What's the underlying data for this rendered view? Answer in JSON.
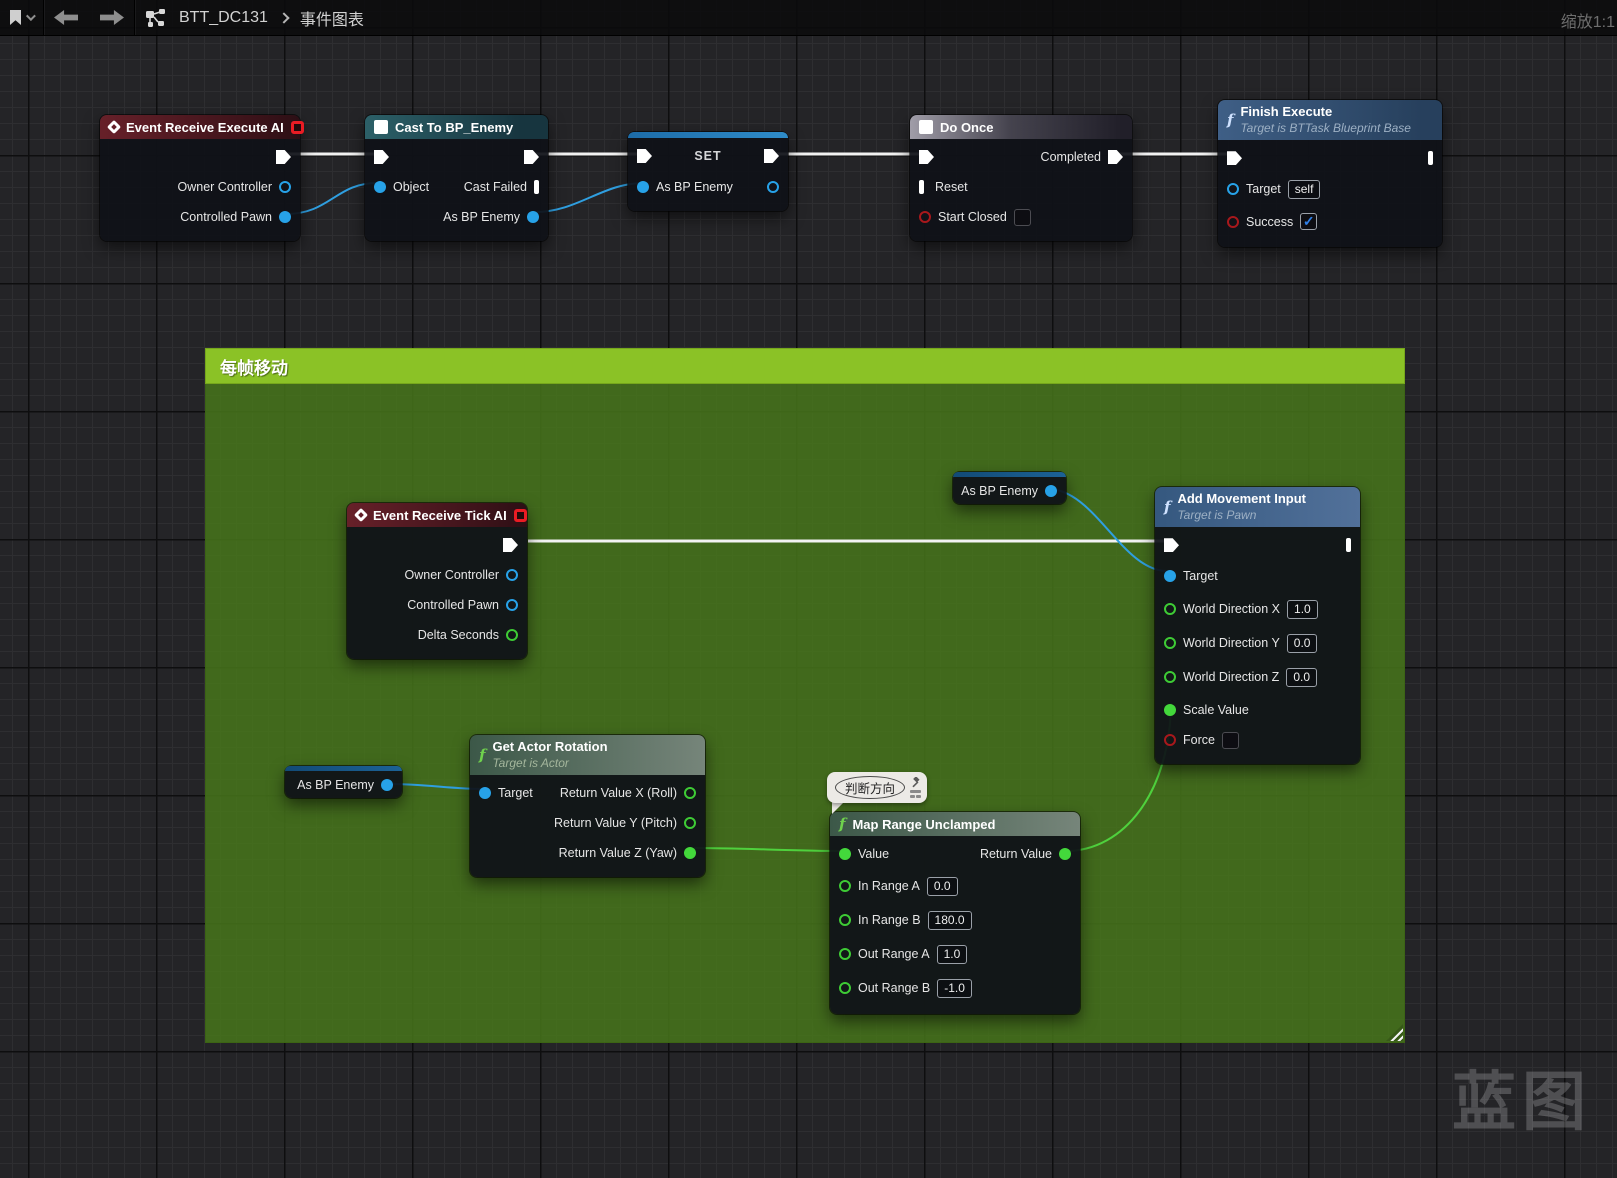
{
  "toolbar": {
    "breadcrumb_root": "BTT_DC131",
    "breadcrumb_page": "事件图表",
    "zoom_label": "缩放1:1"
  },
  "comment": {
    "title": "每帧移动"
  },
  "bubble": {
    "text": "判断方向"
  },
  "watermark": "蓝图",
  "colors": {
    "exec_wire": "#f2f2f2",
    "object_pin": "#27a2e8",
    "float_pin": "#43d83b",
    "bool_pin": "#a8181c",
    "comment_header": "#8bc226"
  },
  "nodes": {
    "event_execute": {
      "title": "Event Receive Execute AI",
      "outputs": [
        "Owner Controller",
        "Controlled Pawn"
      ]
    },
    "cast_to_bp_enemy": {
      "title": "Cast To BP_Enemy",
      "input": "Object",
      "out_fail": "Cast Failed",
      "out_as": "As BP Enemy"
    },
    "set_node": {
      "title": "SET",
      "input": "As BP Enemy"
    },
    "do_once": {
      "title": "Do Once",
      "out_completed": "Completed",
      "in_reset": "Reset",
      "in_start_closed": "Start Closed"
    },
    "finish_execute": {
      "title": "Finish Execute",
      "subtitle": "Target is BTTask Blueprint Base",
      "target_label": "Target",
      "target_value": "self",
      "success_label": "Success"
    },
    "event_tick": {
      "title": "Event Receive Tick AI",
      "outputs": [
        "Owner Controller",
        "Controlled Pawn",
        "Delta Seconds"
      ]
    },
    "var_as_bp_enemy_top": {
      "label": "As BP Enemy"
    },
    "var_as_bp_enemy_bottom": {
      "label": "As BP Enemy"
    },
    "add_movement_input": {
      "title": "Add Movement Input",
      "subtitle": "Target is Pawn",
      "target_label": "Target",
      "wdx_label": "World Direction X",
      "wdx_value": "1.0",
      "wdy_label": "World Direction Y",
      "wdy_value": "0.0",
      "wdz_label": "World Direction Z",
      "wdz_value": "0.0",
      "scale_label": "Scale Value",
      "force_label": "Force"
    },
    "get_actor_rotation": {
      "title": "Get Actor Rotation",
      "subtitle": "Target is Actor",
      "target_label": "Target",
      "outputs": [
        "Return Value X (Roll)",
        "Return Value Y (Pitch)",
        "Return Value Z (Yaw)"
      ]
    },
    "map_range_unclamped": {
      "title": "Map Range Unclamped",
      "value_label": "Value",
      "return_label": "Return Value",
      "in_a_label": "In Range A",
      "in_a_value": "0.0",
      "in_b_label": "In Range B",
      "in_b_value": "180.0",
      "out_a_label": "Out Range A",
      "out_a_value": "1.0",
      "out_b_label": "Out Range B",
      "out_b_value": "-1.0"
    }
  }
}
